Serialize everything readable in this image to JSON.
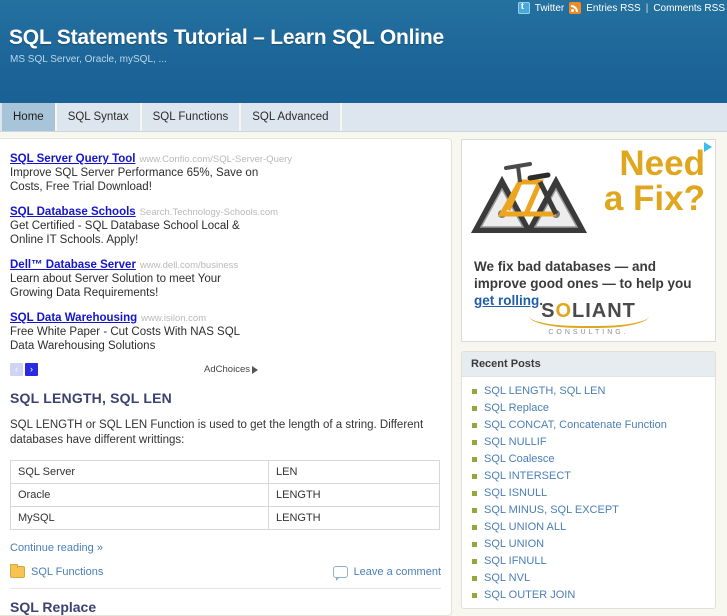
{
  "header": {
    "title": "SQL Statements Tutorial – Learn SQL Online",
    "tagline": "MS SQL Server, Oracle, mySQL, ...",
    "meta": {
      "twitter_label": "Twitter",
      "entries_rss_label": "Entries RSS",
      "separator": "|",
      "comments_rss_label": "Comments RSS",
      "twitter_icon": "twitter-icon",
      "rss_icon": "rss-icon"
    },
    "colors": {
      "banner_bg": "#1d6699",
      "nav_bg": "#dde6ee",
      "active_tab_bg": "#a8c4d8",
      "page_bg": "#f7f6ef"
    }
  },
  "nav": {
    "tabs": [
      {
        "label": "Home",
        "active": true
      },
      {
        "label": "SQL Syntax",
        "active": false
      },
      {
        "label": "SQL Functions",
        "active": false
      },
      {
        "label": "SQL Advanced",
        "active": false
      }
    ]
  },
  "text_ads": {
    "items": [
      {
        "title": "SQL Server Query Tool",
        "url": "www.Confio.com/SQL-Server-Query",
        "desc": "Improve SQL Server Performance 65%, Save on Costs, Free Trial Download!"
      },
      {
        "title": "SQL Database Schools",
        "url": "Search.Technology-Schools.com",
        "desc": "Get Certified - SQL Database School Local & Online IT Schools. Apply!"
      },
      {
        "title": "Dell™ Database Server",
        "url": "www.dell.com/business",
        "desc": "Learn about Server Solution to meet Your Growing Data Requirements!"
      },
      {
        "title": "SQL Data Warehousing",
        "url": "www.isilon.com",
        "desc": "Free White Paper - Cut Costs With NAS SQL Data Warehousing Solutions"
      }
    ],
    "prev_arrow": "‹",
    "next_arrow": "›",
    "adchoices_label": "AdChoices"
  },
  "post": {
    "title": "SQL LENGTH, SQL LEN",
    "paragraph": "SQL LENGTH or SQL LEN Function is used to get the length of a string. Different databases have different writtings:",
    "table": {
      "rows": [
        {
          "database": "SQL Server",
          "function": "LEN"
        },
        {
          "database": "Oracle",
          "function": "LENGTH"
        },
        {
          "database": "MySQL",
          "function": "LENGTH"
        }
      ]
    },
    "continue_label": "Continue reading »",
    "category_label": "SQL Functions",
    "comment_label": "Leave a comment",
    "next_post_title": "SQL Replace"
  },
  "banner_ad": {
    "headline_line1": "Need",
    "headline_line2": "a Fix?",
    "tagline_part1": "We fix bad databases — and improve good ones — to help you ",
    "tagline_link": "get rolling",
    "tagline_part2": ".",
    "brand_name_part1": "S",
    "brand_name_o": "O",
    "brand_name_part2": "LIANT",
    "brand_sub": "CONSULTING.",
    "accent_color": "#e0a71e"
  },
  "sidebar": {
    "recent_posts_title": "Recent Posts",
    "recent_posts": [
      "SQL LENGTH, SQL LEN",
      "SQL Replace",
      "SQL CONCAT, Concatenate Function",
      "SQL NULLIF",
      "SQL Coalesce",
      "SQL INTERSECT",
      "SQL ISNULL",
      "SQL MINUS, SQL EXCEPT",
      "SQL UNION ALL",
      "SQL UNION",
      "SQL IFNULL",
      "SQL NVL",
      "SQL OUTER JOIN"
    ]
  }
}
